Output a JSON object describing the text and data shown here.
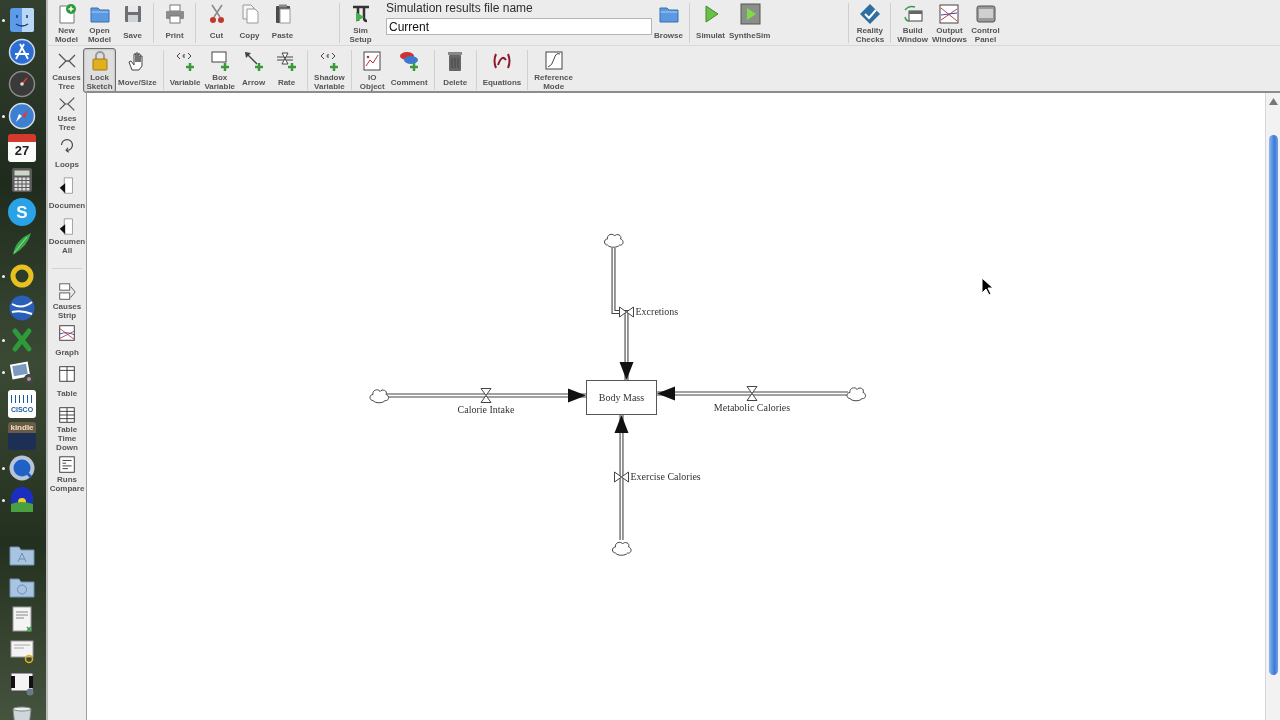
{
  "dock": {
    "apps": [
      {
        "kind": "face",
        "running": true
      },
      {
        "kind": "pencil_disc",
        "running": false
      },
      {
        "kind": "gauge",
        "running": false
      },
      {
        "kind": "compass",
        "running": true
      },
      {
        "kind": "calendar",
        "text": "27",
        "running": false
      },
      {
        "kind": "calculator",
        "running": false
      },
      {
        "kind": "letter_disc",
        "text": "S",
        "running": false
      },
      {
        "kind": "leaf",
        "running": false
      },
      {
        "kind": "ring",
        "running": true
      },
      {
        "kind": "globe",
        "running": false
      },
      {
        "kind": "cross",
        "running": true
      },
      {
        "kind": "photo",
        "running": true
      },
      {
        "kind": "logo_tile",
        "text": "CISCO",
        "running": false
      },
      {
        "kind": "word_tile",
        "text": "kindle",
        "running": false
      },
      {
        "kind": "blue_disc",
        "running": true
      },
      {
        "kind": "landscape",
        "running": true
      }
    ],
    "stacks": [
      {
        "kind": "folder",
        "running": false
      },
      {
        "kind": "folder_down",
        "running": false
      },
      {
        "kind": "doc",
        "running": false
      },
      {
        "kind": "doc_badge",
        "running": false
      },
      {
        "kind": "doc_dark",
        "running": false
      },
      {
        "kind": "trash",
        "running": false
      }
    ]
  },
  "main_toolbar": [
    [
      {
        "kind": "new",
        "label": "New\nModel"
      },
      {
        "kind": "open",
        "label": "Open\nModel"
      },
      {
        "kind": "save",
        "label": "Save"
      }
    ],
    [
      {
        "kind": "print",
        "label": "Print"
      }
    ],
    [
      {
        "kind": "cut",
        "label": "Cut"
      },
      {
        "kind": "copy",
        "label": "Copy"
      },
      {
        "kind": "paste",
        "label": "Paste"
      }
    ],
    [
      {
        "kind": "sim_setup",
        "label": "Sim\nSetup"
      },
      {
        "kind": "file_field",
        "label": "Simulation results file name",
        "value": "Current"
      },
      {
        "kind": "browse",
        "label": "Browse"
      }
    ],
    [
      {
        "kind": "simulate",
        "label": "Simulat"
      },
      {
        "kind": "synthesim",
        "label": "SyntheSim"
      }
    ],
    [
      {
        "kind": "reality",
        "label": "Reality\nChecks"
      }
    ],
    [
      {
        "kind": "build",
        "label": "Build\nWindow"
      },
      {
        "kind": "output",
        "label": "Output\nWindows"
      },
      {
        "kind": "control",
        "label": "Control\nPanel"
      }
    ]
  ],
  "sketch_toolbar": [
    [
      {
        "kind": "causes_tree",
        "label": "Causes\nTree",
        "selected": false
      },
      {
        "kind": "lock",
        "label": "Lock\nSketch",
        "selected": true
      },
      {
        "kind": "move",
        "label": "Move/Size",
        "selected": false
      }
    ],
    [
      {
        "kind": "variable",
        "label": "Variable",
        "selected": false
      },
      {
        "kind": "box_variable",
        "label": "Box\nVariable",
        "selected": false
      },
      {
        "kind": "arrow",
        "label": "Arrow",
        "selected": false
      },
      {
        "kind": "rate",
        "label": "Rate",
        "selected": false
      }
    ],
    [
      {
        "kind": "shadow",
        "label": "Shadow\nVariable",
        "selected": false
      }
    ],
    [
      {
        "kind": "io",
        "label": "IO\nObject",
        "selected": false
      },
      {
        "kind": "comment",
        "label": "Comment",
        "selected": false
      }
    ],
    [
      {
        "kind": "delete",
        "label": "Delete",
        "selected": false
      }
    ],
    [
      {
        "kind": "equations",
        "label": "Equations",
        "selected": false
      }
    ],
    [
      {
        "kind": "reference",
        "label": "Reference\nMode",
        "selected": false
      }
    ]
  ],
  "side_tools": [
    [
      {
        "kind": "uses_tree",
        "label": "Uses\nTree"
      },
      {
        "kind": "loops",
        "label": "Loops"
      },
      {
        "kind": "document",
        "label": "Documen"
      },
      {
        "kind": "document_all",
        "label": "Documen\nAll"
      }
    ],
    [
      {
        "kind": "causes_strip",
        "label": "Causes\nStrip"
      },
      {
        "kind": "graph",
        "label": "Graph"
      },
      {
        "kind": "table",
        "label": "Table"
      },
      {
        "kind": "table_time_down",
        "label": "Table\nTime\nDown"
      },
      {
        "kind": "runs_compare",
        "label": "Runs\nCompare"
      }
    ]
  ],
  "diagram": {
    "stocks": [
      {
        "label": "Body Mass"
      }
    ],
    "flows": [
      {
        "label": "Excretions",
        "bent": true
      },
      {
        "label": "Calorie Intake",
        "bent": false
      },
      {
        "label": "Metabolic Calories",
        "bent": false
      },
      {
        "label": "Exercise Calories",
        "bent": false
      }
    ]
  }
}
